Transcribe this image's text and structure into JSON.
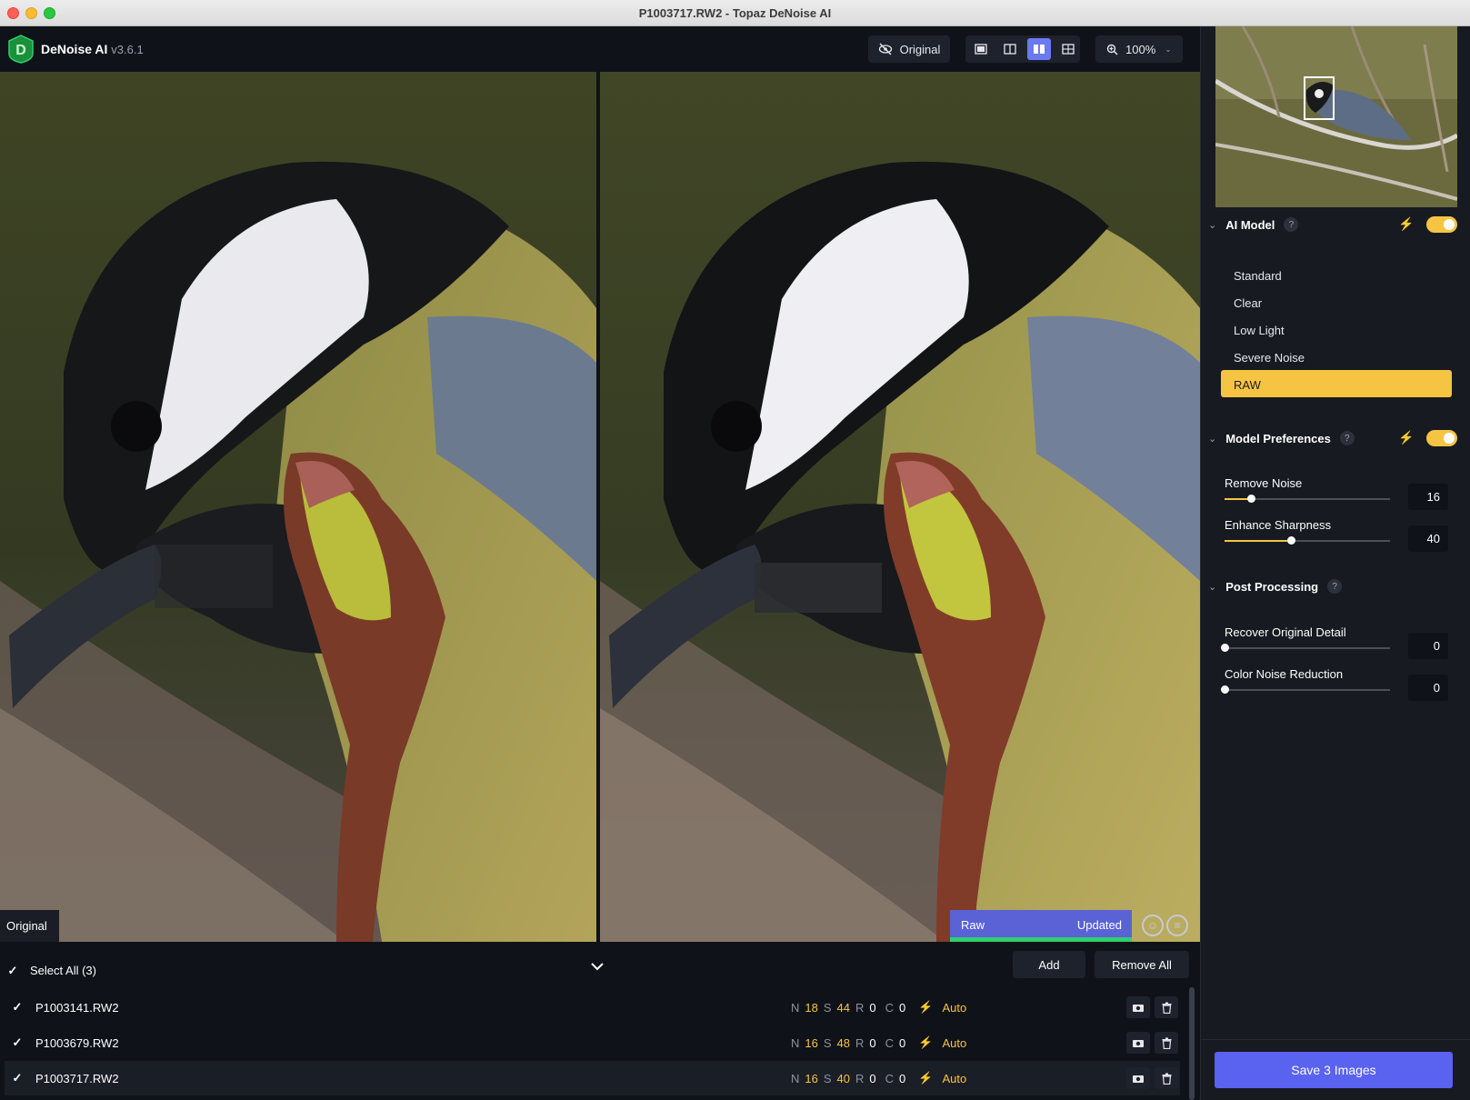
{
  "window": {
    "title": "P1003717.RW2 - Topaz DeNoise AI"
  },
  "header": {
    "logo_letter": "D",
    "app_name": "DeNoise AI",
    "version": "v3.6.1",
    "original_button": "Original",
    "zoom": "100%"
  },
  "preview": {
    "original_label": "Original",
    "status_model": "Raw",
    "status_state": "Updated"
  },
  "files": {
    "select_all": "Select All (3)",
    "add_label": "Add",
    "remove_all_label": "Remove All",
    "rows": [
      {
        "name": "P1003141.RW2",
        "n_key": "N",
        "n": "18",
        "s_key": "S",
        "s": "44",
        "r_key": "R",
        "r": "0",
        "c_key": "C",
        "c": "0",
        "mode": "Auto"
      },
      {
        "name": "P1003679.RW2",
        "n_key": "N",
        "n": "16",
        "s_key": "S",
        "s": "48",
        "r_key": "R",
        "r": "0",
        "c_key": "C",
        "c": "0",
        "mode": "Auto"
      },
      {
        "name": "P1003717.RW2",
        "n_key": "N",
        "n": "16",
        "s_key": "S",
        "s": "40",
        "r_key": "R",
        "r": "0",
        "c_key": "C",
        "c": "0",
        "mode": "Auto"
      }
    ]
  },
  "panel": {
    "ai_model": {
      "title": "AI Model",
      "help": "?",
      "items": [
        "Standard",
        "Clear",
        "Low Light",
        "Severe Noise",
        "RAW"
      ],
      "selected": "RAW"
    },
    "model_preferences": {
      "title": "Model Preferences",
      "help": "?",
      "remove_noise": {
        "label": "Remove Noise",
        "value": "16",
        "fraction": 0.16
      },
      "enhance_sharpness": {
        "label": "Enhance Sharpness",
        "value": "40",
        "fraction": 0.4
      }
    },
    "post_processing": {
      "title": "Post Processing",
      "help": "?",
      "recover_detail": {
        "label": "Recover Original Detail",
        "value": "0",
        "fraction": 0
      },
      "color_noise": {
        "label": "Color Noise Reduction",
        "value": "0",
        "fraction": 0
      }
    },
    "save_button": "Save 3 Images"
  },
  "colors": {
    "accent_yellow": "#f6c443",
    "accent_blue": "#5a62f0",
    "updated_green": "#2fd06c",
    "background": "#0f1219",
    "panel": "#171a21"
  },
  "icons": [
    "eye-slash-icon",
    "single-view-icon",
    "split-view-icon",
    "side-by-side-icon",
    "grid-view-icon",
    "zoom-icon",
    "chevron-down-icon",
    "bolt-icon",
    "camera-icon",
    "trash-icon",
    "smile-icon",
    "neutral-face-icon",
    "checkmark-icon"
  ]
}
